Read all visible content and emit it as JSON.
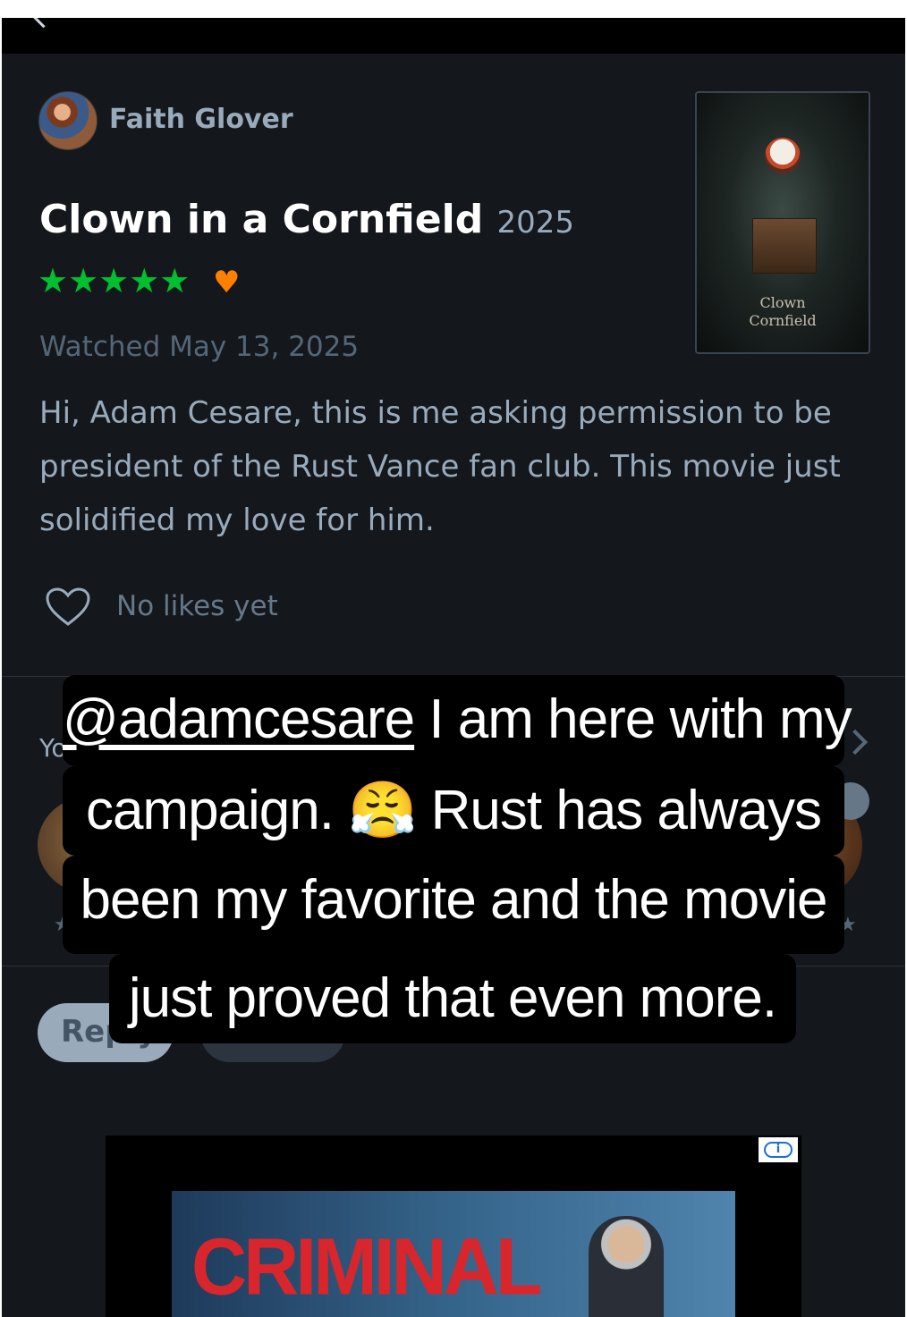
{
  "review": {
    "author": "Faith Glover",
    "film_title": "Clown in a Cornfield",
    "film_year": "2025",
    "rating_stars": "★★★★★",
    "liked_heart": "♥",
    "watched_date": "Watched May 13, 2025",
    "body": "Hi, Adam Cesare, this is me asking permission to be president of the Rust Vance fan club. This movie just solidified my love for him.",
    "likes_text": "No likes yet"
  },
  "poster": {
    "title_line1": "Clown",
    "title_line2": "Cornfield"
  },
  "friends_section": {
    "label_visible": "Yo"
  },
  "actions": {
    "reply_label": "Reply"
  },
  "ad": {
    "headline": "CRIMINAL",
    "info_label": "i"
  },
  "caption": {
    "mention": "@adamcesare",
    "line1_rest": " I am here with my",
    "line2": "campaign. 😤 Rust has always",
    "line3": "been my favorite and the movie",
    "line4": "just proved that even more."
  },
  "colors": {
    "background": "#14181c",
    "star_green": "#00c030",
    "heart_orange": "#ff8000",
    "muted_text": "#99aabb"
  }
}
